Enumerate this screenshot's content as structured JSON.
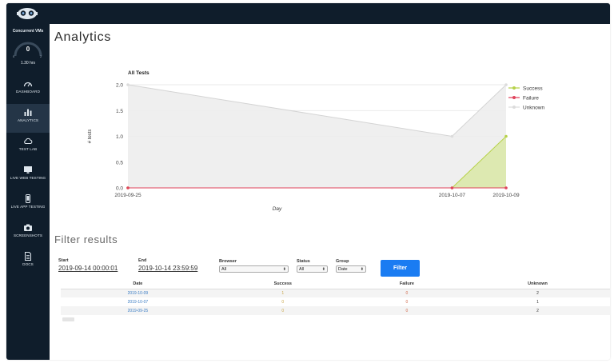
{
  "sidebar": {
    "title": "Concurrent VMs",
    "gauge_value": "0",
    "gauge_min": "0",
    "gauge_max": "2",
    "gauge_level": 0,
    "hours": "1.30 hrs",
    "items": [
      {
        "label": "DASHBOARD",
        "icon": "gauge-icon"
      },
      {
        "label": "ANALYTICS",
        "icon": "bar-chart-icon"
      },
      {
        "label": "TEST LAB",
        "icon": "cloud-icon"
      },
      {
        "label": "LIVE WEB TESTING",
        "icon": "monitor-icon"
      },
      {
        "label": "LIVE APP TESTING",
        "icon": "phone-icon"
      },
      {
        "label": "SCREENSHOTS",
        "icon": "camera-icon"
      },
      {
        "label": "DOCS",
        "icon": "document-icon"
      }
    ],
    "active_item": "ANALYTICS"
  },
  "page": {
    "title": "Analytics"
  },
  "chart_data": {
    "type": "area",
    "title": "All Tests",
    "xlabel": "Day",
    "ylabel": "# tests",
    "categories": [
      "2019-09-25",
      "2019-10-07",
      "2019-10-09"
    ],
    "ylim": [
      0,
      2
    ],
    "yticks": [
      "0.0",
      "0.5",
      "1.0",
      "1.5",
      "2.0"
    ],
    "grid": true,
    "legend_position": "top-right",
    "series": [
      {
        "name": "Success",
        "values": [
          0,
          0,
          1
        ],
        "color": "#b7d24a"
      },
      {
        "name": "Failure",
        "values": [
          0,
          0,
          0
        ],
        "color": "#e0455d"
      },
      {
        "name": "Unknown",
        "values": [
          2,
          1,
          2
        ],
        "color": "#e6e6e6"
      }
    ]
  },
  "filter": {
    "title": "Filter results",
    "start_label": "Start",
    "start_value": "2019-09-14 00:00:01",
    "end_label": "End",
    "end_value": "2019-10-14 23:59:59",
    "browser_label": "Browser",
    "browser_value": "All",
    "status_label": "Status",
    "status_value": "All",
    "group_label": "Group",
    "group_value": "Date",
    "button_label": "Filter"
  },
  "table": {
    "headers": [
      "Date",
      "Success",
      "Failure",
      "Unknown"
    ],
    "rows": [
      [
        "2019-10-09",
        "1",
        "0",
        "2"
      ],
      [
        "2019-10-07",
        "0",
        "0",
        "1"
      ],
      [
        "2019-09-25",
        "0",
        "0",
        "2"
      ]
    ]
  },
  "colors": {
    "sidebar_bg": "#0f1d2b",
    "sidebar_active": "#243547",
    "accent": "#1a7cf2"
  }
}
